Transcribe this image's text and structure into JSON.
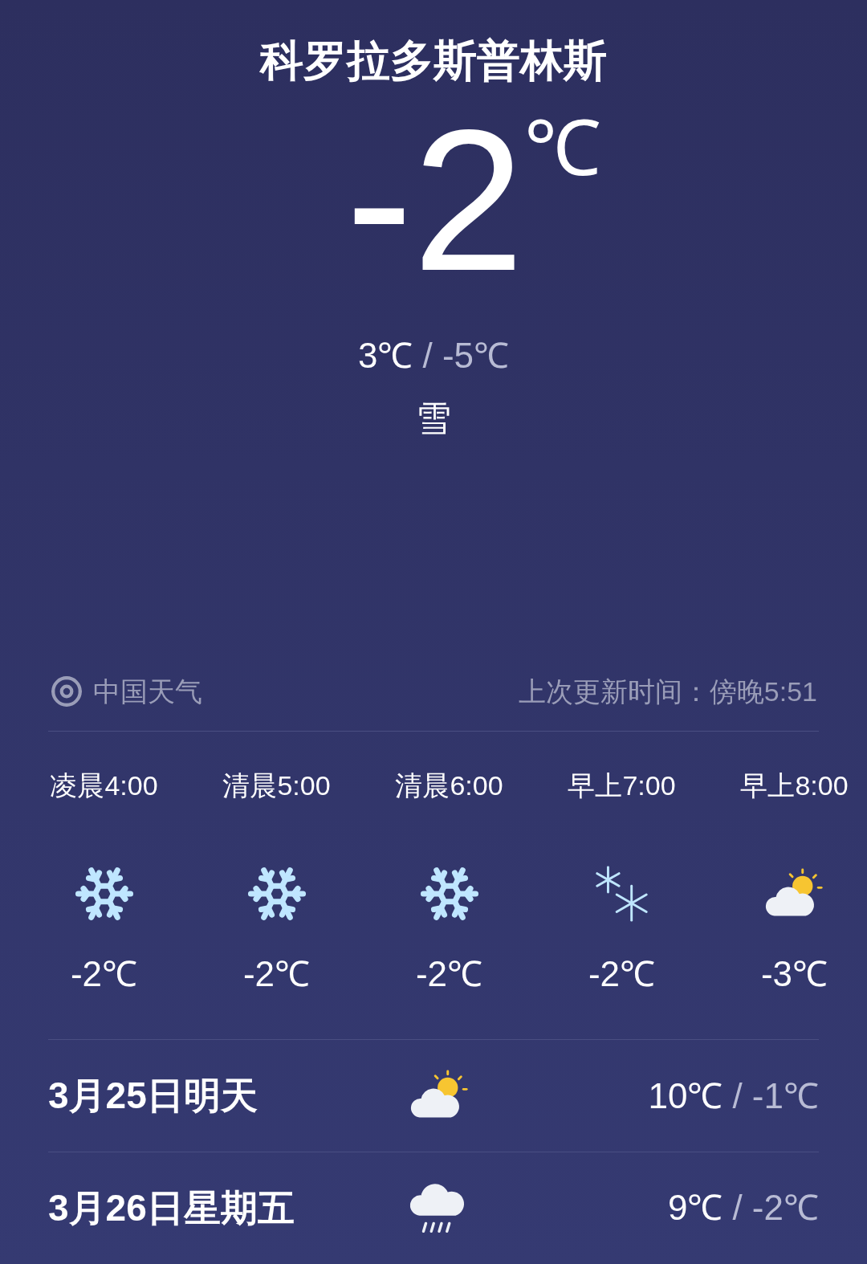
{
  "city": "科罗拉多斯普林斯",
  "current": {
    "temp": "-2",
    "unit": "℃",
    "high": "3℃",
    "low": "/ -5℃",
    "condition": "雪"
  },
  "source": {
    "name": "中国天气",
    "updated": "上次更新时间：傍晚5:51"
  },
  "hourly": [
    {
      "time": "凌晨4:00",
      "kind": "snow",
      "temp": "-2℃"
    },
    {
      "time": "清晨5:00",
      "kind": "snow",
      "temp": "-2℃"
    },
    {
      "time": "清晨6:00",
      "kind": "snow",
      "temp": "-2℃"
    },
    {
      "time": "早上7:00",
      "kind": "light-snow",
      "temp": "-2℃"
    },
    {
      "time": "早上8:00",
      "kind": "partly-cloudy",
      "temp": "-3℃"
    }
  ],
  "daily": [
    {
      "date": "3月25日明天",
      "kind": "partly-cloudy",
      "high": "10℃",
      "low": "/ -1℃"
    },
    {
      "date": "3月26日星期五",
      "kind": "rain",
      "high": "9℃",
      "low": "/ -2℃"
    }
  ]
}
